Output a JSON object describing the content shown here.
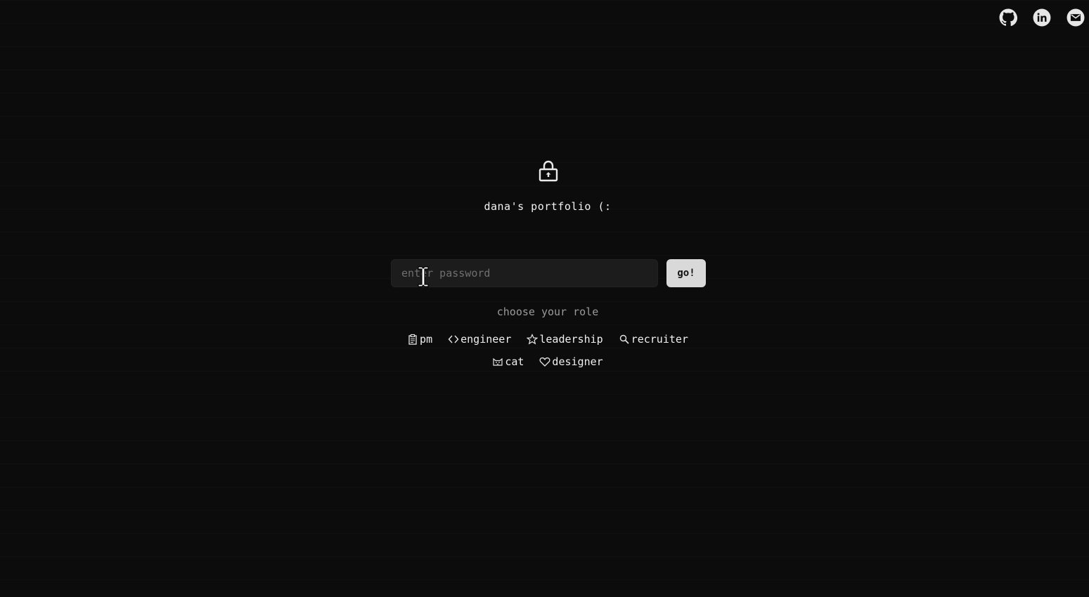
{
  "header": {
    "links": [
      {
        "name": "github",
        "icon": "github-icon"
      },
      {
        "name": "linkedin",
        "icon": "linkedin-icon"
      },
      {
        "name": "email",
        "icon": "mail-icon"
      }
    ]
  },
  "main": {
    "lock_icon": "lock-icon",
    "title": "dana's portfolio (:",
    "password": {
      "placeholder": "enter password",
      "value": ""
    },
    "go_label": "go!",
    "role_prompt": "choose your role",
    "roles": [
      {
        "label": "pm",
        "icon": "clipboard-icon"
      },
      {
        "label": "engineer",
        "icon": "code-icon"
      },
      {
        "label": "leadership",
        "icon": "star-icon"
      },
      {
        "label": "recruiter",
        "icon": "search-icon"
      },
      {
        "label": "cat",
        "icon": "cat-icon"
      },
      {
        "label": "designer",
        "icon": "heart-icon"
      }
    ]
  },
  "colors": {
    "background": "#0c0c0c",
    "input_bg": "#1c1c1c",
    "button_bg": "#d9d9d9",
    "text": "#f0f0f0",
    "muted": "#9a9a9a"
  }
}
